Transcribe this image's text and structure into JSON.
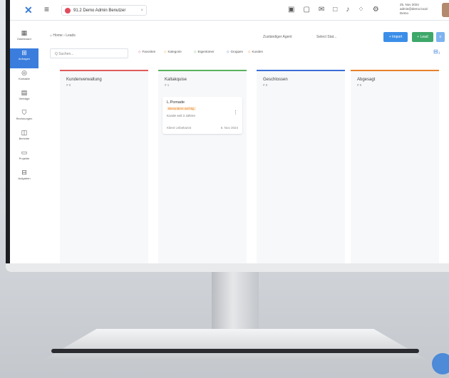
{
  "app": {
    "tab_title": "91.2 Demo Admin Benutzer",
    "user_lines": [
      "25. Nov 2024",
      "admin@demo.local",
      "Demo"
    ]
  },
  "sidebar": {
    "items": [
      {
        "label": "Dashboard",
        "icon": "grid-icon"
      },
      {
        "label": "Anfragen",
        "icon": "inbox-icon",
        "active": true
      },
      {
        "label": "Kontakte",
        "icon": "contact-icon"
      },
      {
        "label": "Verträge",
        "icon": "contract-icon"
      },
      {
        "label": "Rechnungen",
        "icon": "invoice-icon"
      },
      {
        "label": "Berichte",
        "icon": "report-icon"
      },
      {
        "label": "Projekte",
        "icon": "folder-icon"
      },
      {
        "label": "Aufgaben",
        "icon": "task-icon"
      }
    ]
  },
  "header": {
    "breadcrumb": "Home › Leads",
    "assignee_filter": "Zuständiger Agent",
    "status_select": "Select Stat...",
    "import_label": "+ Import",
    "lead_label": "+ Lead"
  },
  "filters": {
    "search_placeholder": "Q  Suchen...",
    "chips": [
      "Favoriten",
      "Kategorie",
      "Eigentümer",
      "Gruppen",
      "Kunden"
    ]
  },
  "columns": [
    {
      "title": "Kundenverwaltung",
      "count": "# 0",
      "color": "#e05b5b"
    },
    {
      "title": "Kaltakquise",
      "count": "# 1",
      "color": "#58b35d"
    },
    {
      "title": "Geschlossen",
      "count": "# 0",
      "color": "#3b6ed8"
    },
    {
      "title": "Abgesagt",
      "count": "# 0",
      "color": "#e8802a"
    }
  ],
  "card": {
    "name": "L.Pomade",
    "tag": "Besonders wichtig",
    "desc": "Kunde seit 3 Jahren",
    "foot": "Klient Unbekannt",
    "date": "6. Nov 2024"
  }
}
